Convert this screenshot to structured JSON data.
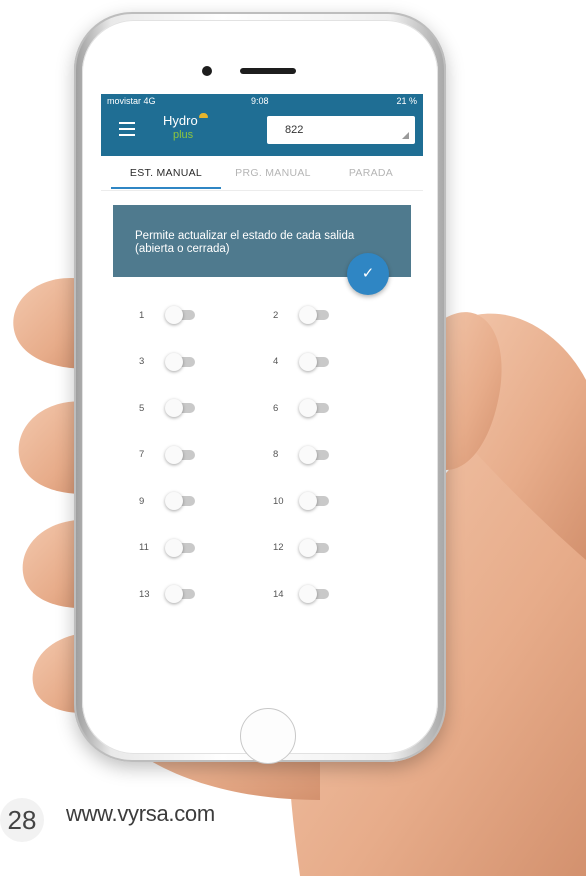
{
  "status_bar": {
    "carrier": "movistar 4G",
    "time": "9:08",
    "battery": "21 %"
  },
  "app_bar": {
    "logo_main": "Hydro",
    "logo_sub": "plus",
    "device_selected": "822"
  },
  "tabs": [
    {
      "label": "EST. MANUAL",
      "active": true
    },
    {
      "label": "PRG. MANUAL",
      "active": false
    },
    {
      "label": "PARADA",
      "active": false
    }
  ],
  "info_banner": {
    "text": "Permite actualizar el estado de cada salida (abierta o cerrada)"
  },
  "confirm_button": {
    "icon": "check-icon",
    "glyph": "✓"
  },
  "outputs": [
    {
      "label": "1",
      "state": "off"
    },
    {
      "label": "2",
      "state": "off"
    },
    {
      "label": "3",
      "state": "off"
    },
    {
      "label": "4",
      "state": "off"
    },
    {
      "label": "5",
      "state": "off"
    },
    {
      "label": "6",
      "state": "off"
    },
    {
      "label": "7",
      "state": "off"
    },
    {
      "label": "8",
      "state": "off"
    },
    {
      "label": "9",
      "state": "off"
    },
    {
      "label": "10",
      "state": "off"
    },
    {
      "label": "11",
      "state": "off"
    },
    {
      "label": "12",
      "state": "off"
    },
    {
      "label": "13",
      "state": "off"
    },
    {
      "label": "14",
      "state": "off"
    }
  ],
  "footer": {
    "page_number": "28",
    "url": "www.vyrsa.com"
  },
  "colors": {
    "primary": "#1f6e94",
    "accent": "#2f86c4",
    "banner": "#4f7a8e",
    "logo_green": "#8dc63f"
  }
}
